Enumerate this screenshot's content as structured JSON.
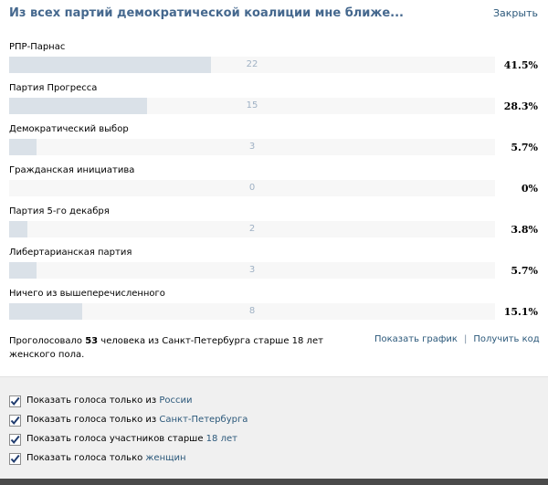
{
  "header": {
    "title": "Из всех партий демократической коалиции мне ближе...",
    "close_label": "Закрыть"
  },
  "options": [
    {
      "label": "РПР-Парнас",
      "count": "22",
      "percent": "41.5%",
      "fraction": 0.415
    },
    {
      "label": "Партия Прогресса",
      "count": "15",
      "percent": "28.3%",
      "fraction": 0.283
    },
    {
      "label": "Демократический выбор",
      "count": "3",
      "percent": "5.7%",
      "fraction": 0.057
    },
    {
      "label": "Гражданская инициатива",
      "count": "0",
      "percent": "0%",
      "fraction": 0.0
    },
    {
      "label": "Партия 5-го декабря",
      "count": "2",
      "percent": "3.8%",
      "fraction": 0.038
    },
    {
      "label": "Либертарианская партия",
      "count": "3",
      "percent": "5.7%",
      "fraction": 0.057
    },
    {
      "label": "Ничего из вышеперечисленного",
      "count": "8",
      "percent": "15.1%",
      "fraction": 0.151
    }
  ],
  "summary": {
    "prefix": "Проголосовало ",
    "voters": "53",
    "suffix": " человека из Санкт-Петербурга старше 18 лет женского пола."
  },
  "links": {
    "show_graph": "Показать график",
    "separator": "|",
    "get_code": "Получить код"
  },
  "filters": [
    {
      "text": "Показать голоса только из ",
      "highlight": "России",
      "checked": true
    },
    {
      "text": "Показать голоса только из ",
      "highlight": "Санкт-Петербурга",
      "checked": true
    },
    {
      "text": "Показать голоса участников старше ",
      "highlight": "18 лет",
      "checked": true
    },
    {
      "text": "Показать голоса только ",
      "highlight": "женщин",
      "checked": true
    }
  ],
  "colors": {
    "accent": "#2b587a",
    "title": "#45688e",
    "bar_fill": "#dae1e8",
    "bar_track": "#f7f7f7",
    "panel": "#f0f0f0"
  },
  "icons": {
    "checkbox": "checkmark-icon"
  }
}
